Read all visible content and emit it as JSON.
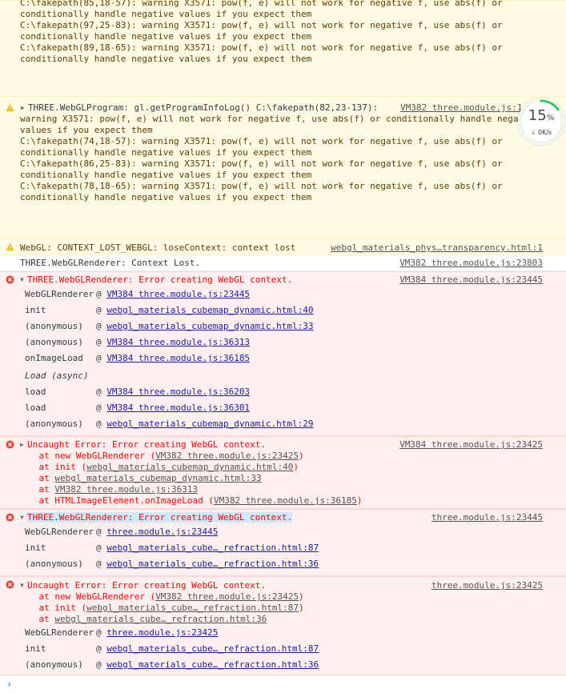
{
  "block1": {
    "lines": [
      "C:\\fakepath(85,18-57): warning X3571: pow(f, e) will not work for negative f, use abs(f) or",
      "conditionally handle negative values if you expect them",
      "C:\\fakepath(97,25-83): warning X3571: pow(f, e) will not work for negative f, use abs(f) or",
      "conditionally handle negative values if you expect them",
      "C:\\fakepath(89,18-65): warning X3571: pow(f, e) will not work for negative f, use abs(f) or",
      "conditionally handle negative values if you expect them"
    ]
  },
  "block2": {
    "first_line": "THREE.WebGLProgram: gl.getProgramInfoLog() C:\\fakepath(82,23-137):",
    "source": "VM382 three.module.js:1",
    "lines": [
      "warning X3571: pow(f, e) will not work for negative f, use abs(f) or conditionally handle negat",
      "values if you expect them",
      "C:\\fakepath(74,18-57): warning X3571: pow(f, e) will not work for negative f, use abs(f) or",
      "conditionally handle negative values if you expect them",
      "C:\\fakepath(86,25-83): warning X3571: pow(f, e) will not work for negative f, use abs(f) or",
      "conditionally handle negative values if you expect them",
      "C:\\fakepath(78,18-65): warning X3571: pow(f, e) will not work for negative f, use abs(f) or",
      "conditionally handle negative values if you expect them"
    ]
  },
  "warn_lost": {
    "text": "WebGL: CONTEXT_LOST_WEBGL: loseContext: context lost",
    "source": "webgl_materials_phys…transparency.html:1"
  },
  "info_lost": {
    "text": "THREE.WebGLRenderer: Context Lost.",
    "source": "VM382 three.module.js:23803"
  },
  "err1": {
    "title": "THREE.WebGLRenderer: Error creating WebGL context.",
    "source": "VM384 three.module.js:23445",
    "stack": [
      {
        "fn": "WebGLRenderer",
        "at": "@",
        "link": "VM384 three.module.js:23445"
      },
      {
        "fn": "init",
        "at": "@",
        "link": "webgl_materials_cubemap_dynamic.html:40"
      },
      {
        "fn": "(anonymous)",
        "at": "@",
        "link": "webgl_materials_cubemap_dynamic.html:33"
      },
      {
        "fn": "(anonymous)",
        "at": "@",
        "link": "VM384 three.module.js:36313"
      },
      {
        "fn": "onImageLoad",
        "at": "@",
        "link": "VM384 three.module.js:36185"
      },
      {
        "fn": "Load (async)",
        "at": "",
        "link": ""
      },
      {
        "fn": "load",
        "at": "@",
        "link": "VM384 three.module.js:36203"
      },
      {
        "fn": "load",
        "at": "@",
        "link": "VM384 three.module.js:36301"
      },
      {
        "fn": "(anonymous)",
        "at": "@",
        "link": "webgl_materials_cubemap_dynamic.html:29"
      }
    ]
  },
  "err2": {
    "title": "Uncaught Error: Error creating WebGL context.",
    "source": "VM384 three.module.js:23425",
    "trace": [
      {
        "prefix": "    at new WebGLRenderer (",
        "link": "VM382 three.module.js:23425",
        "suffix": ")"
      },
      {
        "prefix": "    at init (",
        "link": "webgl_materials_cubemap_dynamic.html:40",
        "suffix": ")"
      },
      {
        "prefix": "    at ",
        "link": "webgl_materials_cubemap_dynamic.html:33",
        "suffix": ""
      },
      {
        "prefix": "    at ",
        "link": "VM382 three.module.js:36313",
        "suffix": ""
      },
      {
        "prefix": "    at HTMLImageElement.onImageLoad (",
        "link": "VM382 three.module.js:36185",
        "suffix": ")"
      }
    ]
  },
  "err3": {
    "title": "THREE.WebGLRenderer: Error creating WebGL context.",
    "source": "three.module.js:23445",
    "stack": [
      {
        "fn": "WebGLRenderer",
        "at": "@",
        "link": "three.module.js:23445"
      },
      {
        "fn": "init",
        "at": "@",
        "link": "webgl_materials_cube…_refraction.html:87"
      },
      {
        "fn": "(anonymous)",
        "at": "@",
        "link": "webgl_materials_cube…_refraction.html:36"
      }
    ]
  },
  "err4": {
    "title": "Uncaught Error: Error creating WebGL context.",
    "source": "three.module.js:23425",
    "trace": [
      {
        "prefix": "    at new WebGLRenderer (",
        "link": "VM382 three.module.js:23425",
        "suffix": ")"
      },
      {
        "prefix": "    at init (",
        "link": "webgl_materials_cube…_refraction.html:87",
        "suffix": ")"
      },
      {
        "prefix": "    at ",
        "link": "webgl_materials_cube…_refraction.html:36",
        "suffix": ""
      }
    ],
    "stack": [
      {
        "fn": "WebGLRenderer",
        "at": "@",
        "link": "three.module.js:23425"
      },
      {
        "fn": "init",
        "at": "@",
        "link": "webgl_materials_cube…_refraction.html:87"
      },
      {
        "fn": "(anonymous)",
        "at": "@",
        "link": "webgl_materials_cube…_refraction.html:36"
      }
    ]
  },
  "badge": {
    "percent": "15",
    "percent_unit": "%",
    "speed": "0K/s",
    "progress": 0.15,
    "ring_color": "#34c759"
  },
  "prompt_symbol": "›",
  "colors": {
    "warning_bg": "#fffbe5",
    "error_bg": "#fff0f0",
    "error_text": "#ff0000"
  }
}
